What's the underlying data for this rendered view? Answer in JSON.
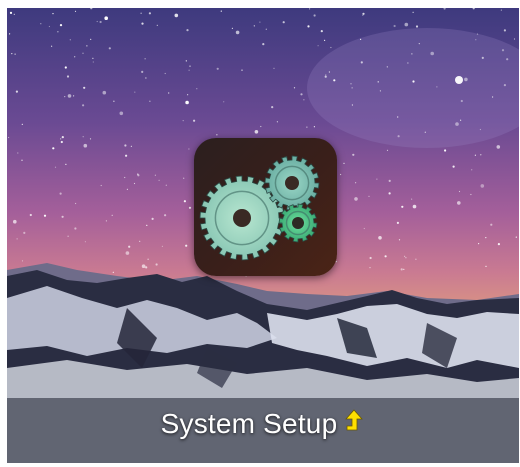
{
  "tile": {
    "label": "System Setup",
    "app_icon": "gears-icon",
    "badge_icon": "arrow-up-icon",
    "badge_color": "#ffe000",
    "background": "starry-night-mountain"
  }
}
